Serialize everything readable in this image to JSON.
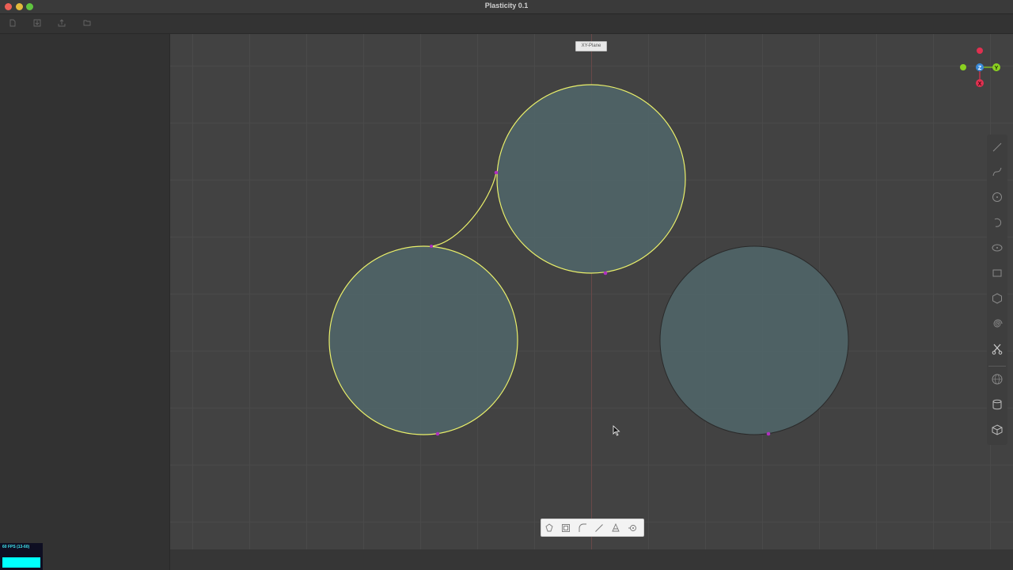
{
  "window": {
    "title": "Plasticity 0.1"
  },
  "toolbar": {
    "icons": [
      "new-file-icon",
      "import-icon",
      "export-icon",
      "open-folder-icon"
    ]
  },
  "viewport": {
    "plane_label": "XY-Plane",
    "background": "#424242",
    "grid_color": "#4a4a4a",
    "axis_color": "#6a4848",
    "curve_highlight_color": "#eaf06a",
    "fill_color": "#4f6366",
    "control_point_color": "#b030c0"
  },
  "gizmo": {
    "axes": [
      "Z",
      "Y",
      "X"
    ],
    "colors": {
      "x": "#e03050",
      "y": "#8ad020",
      "z": "#3a8ad8"
    }
  },
  "stats": {
    "fps_label": "60 FPS (13-60)",
    "bar_color": "#00ffff"
  },
  "right_toolbar": {
    "tools": [
      "line-icon",
      "curve-icon",
      "circle-icon",
      "arc-icon",
      "ellipse-icon",
      "rectangle-icon",
      "polygon-icon",
      "spiral-icon",
      "scissors-icon"
    ],
    "solids": [
      "sphere-icon",
      "cylinder-icon",
      "box-icon"
    ]
  },
  "bottom_toolbar": {
    "icons": [
      "extrude-icon",
      "offset-icon",
      "fillet-icon",
      "line-tool-icon",
      "cone-icon",
      "snap-icon"
    ]
  }
}
